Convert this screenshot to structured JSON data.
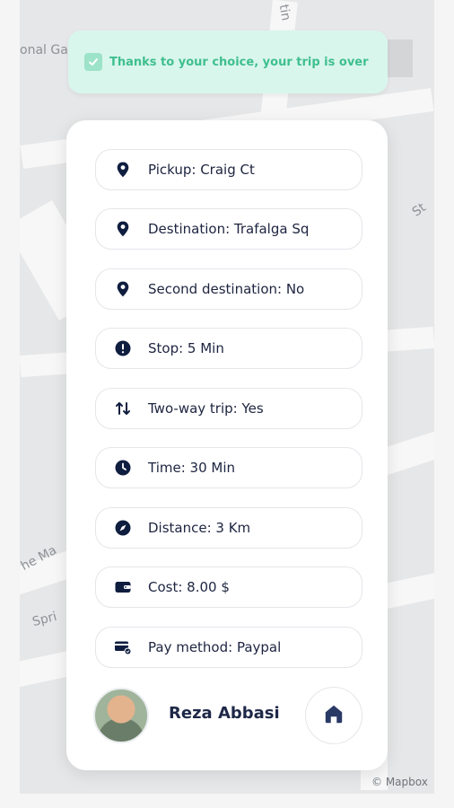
{
  "map": {
    "labels": [
      "onal Ga",
      "tin",
      "St",
      "he Ma",
      "Spri"
    ],
    "attribution": "© Mapbox"
  },
  "toast": {
    "message": "Thanks to your choice, your trip is over",
    "icon": "check-icon",
    "color": "#3fbf8e"
  },
  "details": [
    {
      "icon": "location-pin-icon",
      "label": "Pickup: Craig Ct"
    },
    {
      "icon": "location-pin-icon",
      "label": "Destination: Trafalga Sq"
    },
    {
      "icon": "location-pin-icon",
      "label": "Second destination: No"
    },
    {
      "icon": "alert-icon",
      "label": "Stop: 5 Min"
    },
    {
      "icon": "swap-arrows-icon",
      "label": "Two-way trip: Yes"
    },
    {
      "icon": "clock-icon",
      "label": "Time: 30 Min"
    },
    {
      "icon": "compass-icon",
      "label": "Distance: 3 Km"
    },
    {
      "icon": "wallet-icon",
      "label": "Cost: 8.00 $"
    },
    {
      "icon": "card-payment-icon",
      "label": "Pay method: Paypal"
    }
  ],
  "driver": {
    "name": "Reza Abbasi",
    "avatar": "driver-avatar"
  },
  "home_button": {
    "icon": "home-icon"
  },
  "colors": {
    "icon": "#0f1d3f",
    "text": "#1d2440",
    "accent_green": "#3fbf8e"
  }
}
